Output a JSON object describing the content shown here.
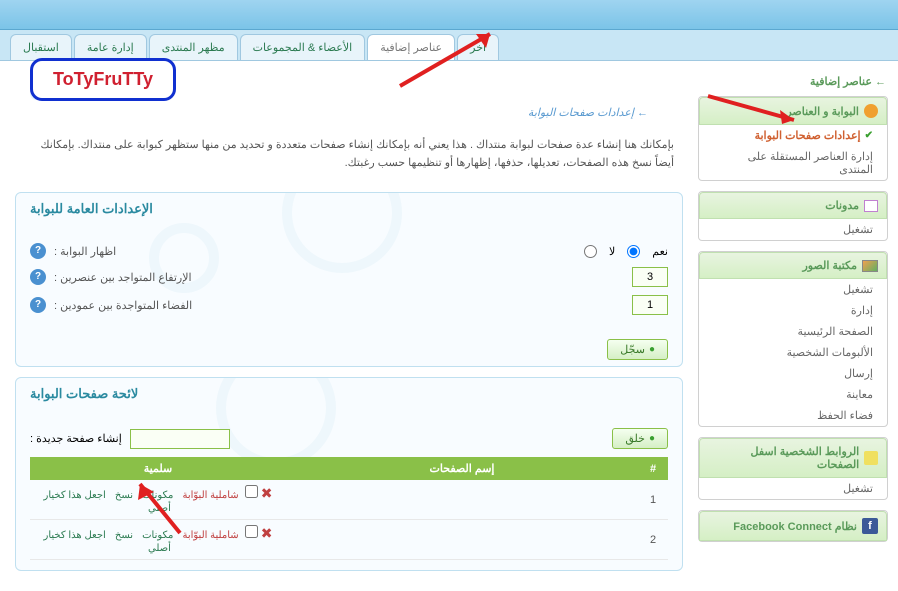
{
  "tabs": [
    "آخر",
    "عناصر إضافية",
    "الأعضاء & المجموعات",
    "مظهر المنتدى",
    "إدارة عامة",
    "استقبال"
  ],
  "active_tab": 1,
  "sidebar": {
    "title": "عناصر إضافية",
    "groups": [
      {
        "icon": "globe",
        "head": "البوابة و العناصر",
        "items": [
          {
            "t": "إعدادات صفحات البوابة",
            "sel": true
          },
          {
            "t": "إدارة العناصر المستقلة على المنتدى"
          }
        ]
      },
      {
        "icon": "blog",
        "head": "مدونات",
        "items": [
          {
            "t": "تشغيل"
          }
        ]
      },
      {
        "icon": "pic",
        "head": "مكتبة الصور",
        "items": [
          {
            "t": "تشغيل"
          },
          {
            "t": "إدارة"
          },
          {
            "t": "الصفحة الرئيسية"
          },
          {
            "t": "الألبومات الشخصية"
          },
          {
            "t": "إرسال"
          },
          {
            "t": "معاينة"
          },
          {
            "t": "فضاء الحفظ"
          }
        ]
      },
      {
        "icon": "link",
        "head": "الروابط الشخصية اسفل الصفحات",
        "items": [
          {
            "t": "تشغيل"
          }
        ]
      },
      {
        "icon": "fb",
        "head": "نظام Facebook Connect",
        "items": []
      }
    ]
  },
  "page": {
    "title": "البوابة و العناصر",
    "subtitle": "إعدادات صفحات البوابة",
    "desc": "بإمكانك هنا إنشاء عدة صفحات لبوابة منتداك . هذا يعني أنه بإمكانك إنشاء صفحات متعددة و تحديد من منها ستظهر كبوابة على منتداك. بإمكانك أيضاً نسخ هذه الصفحات، تعديلها، حذفها، إظهارها أو تنظيمها حسب رغبتك."
  },
  "sec1": {
    "title": "الإعدادات العامة للبوابة",
    "f1": "اظهار البوابة :",
    "yes": "نعم",
    "no": "لا",
    "f2": "الإرتفاع المتواجد بين عنصرين :",
    "v2": "3",
    "f3": "الفضاء المتواجدة بين عمودين :",
    "v3": "1",
    "btn": "سجّل"
  },
  "sec2": {
    "title": "لائحة صفحات البوابة",
    "newlabel": "إنشاء صفحة جديدة :",
    "btn": "خلق",
    "headers": {
      "n": "#",
      "name": "إسم الصفحات",
      "act": "سلمية"
    },
    "rows": [
      {
        "n": "1",
        "acts": [
          "اجعل هذا كخيار أصلي",
          "نسخ",
          "مكونات",
          "شاملية البوّابة"
        ]
      },
      {
        "n": "2",
        "acts": [
          "اجعل هذا كخيار أصلي",
          "نسخ",
          "مكونات",
          "شاملية البوّابة"
        ]
      }
    ]
  },
  "logo": "ToTyFruTTy"
}
